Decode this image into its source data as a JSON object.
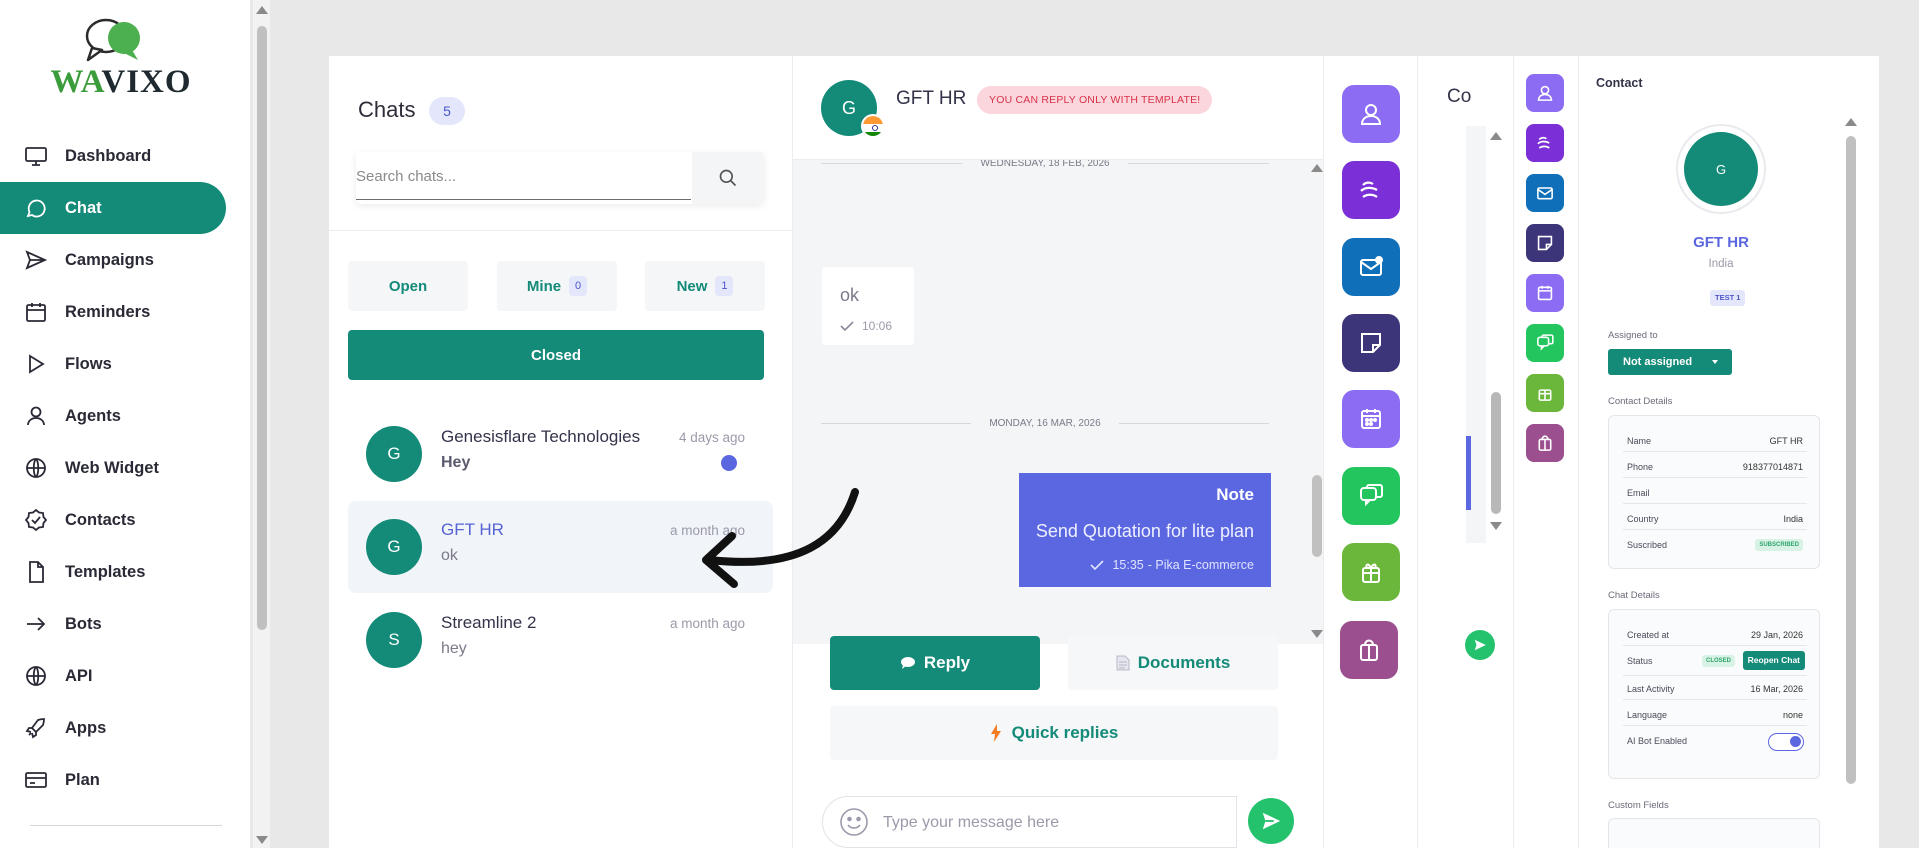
{
  "brand": {
    "wa": "WA",
    "vixo": "VIXO"
  },
  "sidebar": {
    "items": [
      {
        "label": "Dashboard",
        "icon": "monitor-icon"
      },
      {
        "label": "Chat",
        "icon": "chat-bubble-icon",
        "active": true
      },
      {
        "label": "Campaigns",
        "icon": "send-icon"
      },
      {
        "label": "Reminders",
        "icon": "calendar-icon"
      },
      {
        "label": "Flows",
        "icon": "play-icon"
      },
      {
        "label": "Agents",
        "icon": "user-icon"
      },
      {
        "label": "Web Widget",
        "icon": "globe-icon"
      },
      {
        "label": "Contacts",
        "icon": "badge-check-icon"
      },
      {
        "label": "Templates",
        "icon": "file-icon"
      },
      {
        "label": "Bots",
        "icon": "arrow-right-icon"
      },
      {
        "label": "API",
        "icon": "globe-icon"
      },
      {
        "label": "Apps",
        "icon": "rocket-icon"
      },
      {
        "label": "Plan",
        "icon": "credit-card-icon"
      }
    ]
  },
  "chats": {
    "title": "Chats",
    "count": "5",
    "search_placeholder": "Search chats...",
    "tabs": {
      "open": {
        "label": "Open"
      },
      "mine": {
        "label": "Mine",
        "count": "0"
      },
      "new": {
        "label": "New",
        "count": "1"
      },
      "closed": {
        "label": "Closed"
      }
    },
    "list": [
      {
        "initial": "G",
        "name": "Genesisflare Technologies",
        "message": "Hey",
        "time": "4 days ago",
        "unread": true
      },
      {
        "initial": "G",
        "name": "GFT HR",
        "message": "ok",
        "time": "a month ago",
        "selected": true
      },
      {
        "initial": "S",
        "name": "Streamline 2",
        "message": "hey",
        "time": "a month ago"
      }
    ]
  },
  "conversation": {
    "initial": "G",
    "name": "GFT HR",
    "badge": "YOU CAN REPLY ONLY WITH TEMPLATE!",
    "date_top": "WEDNESDAY, 18 FEB, 2026",
    "msg_text": "ok",
    "msg_time": "10:06",
    "date_mid": "MONDAY, 16 MAR, 2026",
    "note": {
      "title": "Note",
      "body": "Send Quotation for lite plan",
      "time": "15:35",
      "author": "- Pika E-commerce"
    },
    "actions": {
      "reply": "Reply",
      "documents": "Documents",
      "quick": "Quick replies"
    },
    "input_placeholder": "Type your message here"
  },
  "second_panel": {
    "title": "Co"
  },
  "contact": {
    "title": "Contact",
    "initial": "G",
    "name": "GFT HR",
    "country": "India",
    "tag": "TEST 1",
    "assigned_label": "Assigned to",
    "assigned_value": "Not assigned",
    "details_label": "Contact Details",
    "details": {
      "name_k": "Name",
      "name_v": "GFT HR",
      "phone_k": "Phone",
      "phone_v": "918377014871",
      "email_k": "Email",
      "email_v": "",
      "country_k": "Country",
      "country_v": "India",
      "subscribed_k": "Suscribed",
      "subscribed_v": "SUBSCRIBED"
    },
    "chat_details_label": "Chat Details",
    "chat_details": {
      "created_k": "Created at",
      "created_v": "29 Jan, 2026",
      "status_k": "Status",
      "status_v": "CLOSED",
      "reopen": "Reopen Chat",
      "activity_k": "Last Activity",
      "activity_v": "16 Mar, 2026",
      "language_k": "Language",
      "language_v": "none",
      "aibot_k": "AI Bot Enabled",
      "aibot_on": true
    },
    "custom_fields_label": "Custom Fields"
  },
  "colors": {
    "primary": "#148a78",
    "accent": "#5b67e0",
    "badge_bg": "#fbd6dc",
    "send": "#25c26e"
  }
}
